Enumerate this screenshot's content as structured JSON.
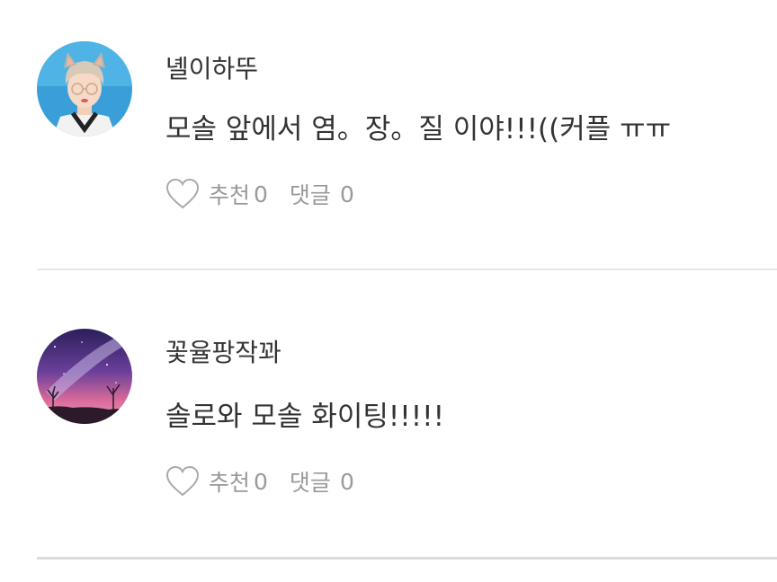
{
  "comments": [
    {
      "nickname": "녤이하뚜",
      "text": "모솔 앞에서 염。장。질 이야!!!((커플 ㅠㅠ",
      "like_label": "추천",
      "like_count": "0",
      "reply_label": "댓글",
      "reply_count": "0",
      "avatar_icon": "profile-photo"
    },
    {
      "nickname": "꽃율팡작꽈",
      "text": "솔로와 모솔 화이팅!!!!!",
      "like_label": "추천",
      "like_count": "0",
      "reply_label": "댓글",
      "reply_count": "0",
      "avatar_icon": "galaxy-landscape"
    }
  ],
  "colors": {
    "text": "#333333",
    "muted": "#999999",
    "divider": "#e4e6ea",
    "avatar1_bg": "#3a9fd8",
    "avatar2_bg": "#5a3a8a"
  }
}
